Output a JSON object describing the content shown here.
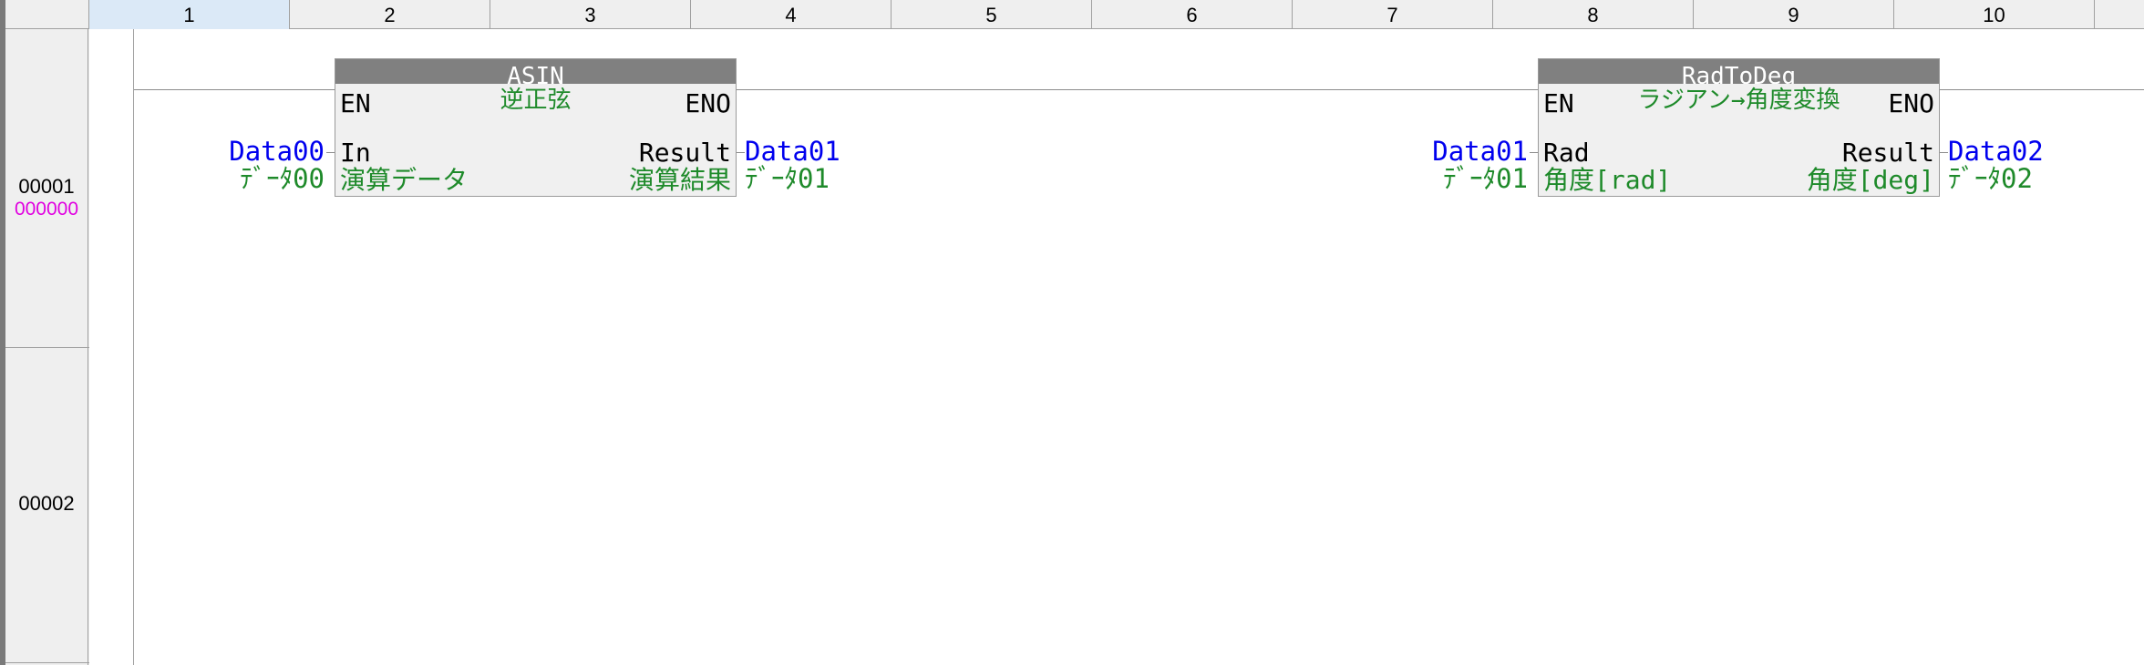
{
  "columns": [
    "1",
    "2",
    "3",
    "4",
    "5",
    "6",
    "7",
    "8",
    "9",
    "10"
  ],
  "rows": [
    {
      "number": "00001",
      "step": "000000"
    },
    {
      "number": "00002",
      "step": ""
    }
  ],
  "blocks": [
    {
      "name": "ASIN",
      "comment": "逆正弦",
      "en": "EN",
      "eno": "ENO",
      "input_pin": "In",
      "input_comment": "演算データ",
      "output_pin": "Result",
      "output_comment": "演算結果",
      "input_var": "Data00",
      "input_var_comment": "ﾃﾞｰﾀ00",
      "output_var": "Data01",
      "output_var_comment": "ﾃﾞｰﾀ01"
    },
    {
      "name": "RadToDeg",
      "comment": "ラジアン→角度変換",
      "en": "EN",
      "eno": "ENO",
      "input_pin": "Rad",
      "input_comment": "角度[rad]",
      "output_pin": "Result",
      "output_comment": "角度[deg]",
      "input_var": "Data01",
      "input_var_comment": "ﾃﾞｰﾀ01",
      "output_var": "Data02",
      "output_var_comment": "ﾃﾞｰﾀ02"
    }
  ]
}
